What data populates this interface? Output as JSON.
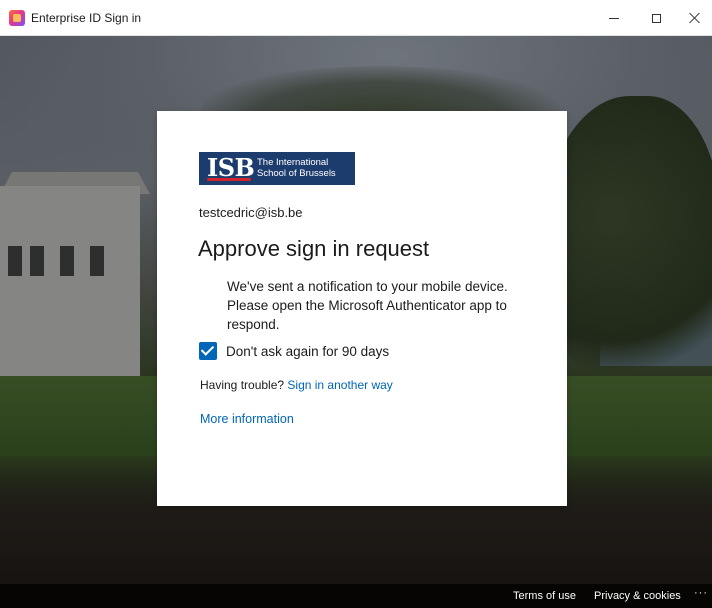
{
  "window": {
    "title": "Enterprise ID Sign in"
  },
  "card": {
    "logo": {
      "mark": "ISB",
      "line1": "The International",
      "line2": "School of Brussels"
    },
    "email": "testcedric@isb.be",
    "heading": "Approve sign in request",
    "message": "We've sent a notification to your mobile device. Please open the Microsoft Authenticator app to respond.",
    "remember": {
      "label": "Don't ask again for 90 days",
      "checked": true
    },
    "trouble_text": "Having trouble?",
    "other_way_link": "Sign in another way",
    "more_info_link": "More information"
  },
  "footer": {
    "terms": "Terms of use",
    "privacy": "Privacy & cookies",
    "more": "···"
  },
  "colors": {
    "link": "#0067b8",
    "checkbox": "#0067b8",
    "logo_bg": "#1d3c6e"
  }
}
